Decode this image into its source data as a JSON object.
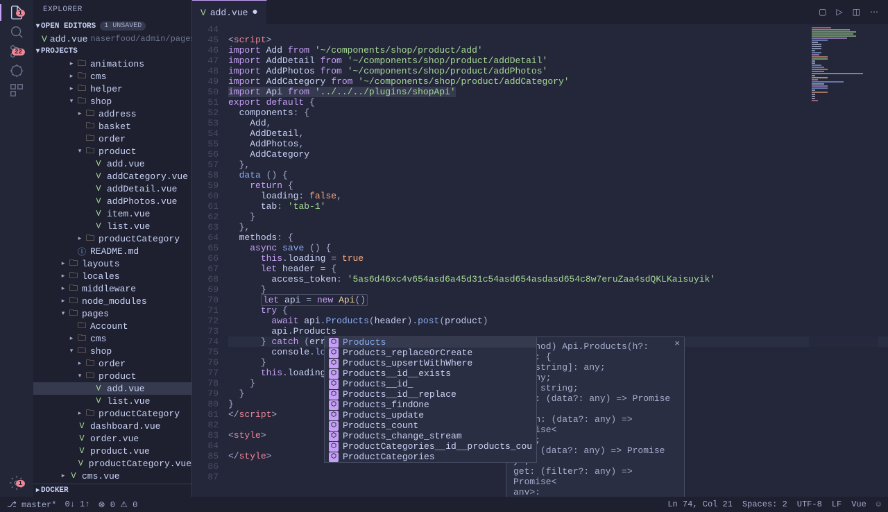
{
  "sidebar": {
    "title": "EXPLORER",
    "openEditors": {
      "label": "OPEN EDITORS",
      "badge": "1 UNSAVED",
      "items": [
        {
          "name": "add.vue",
          "path": "naserfood/admin/pages/shop/p..."
        }
      ]
    },
    "projects": {
      "label": "PROJECTS",
      "tree": [
        {
          "depth": 4,
          "type": "folder",
          "name": "animations",
          "chev": "right"
        },
        {
          "depth": 4,
          "type": "folder",
          "name": "cms",
          "chev": "right"
        },
        {
          "depth": 4,
          "type": "folder",
          "name": "helper",
          "chev": "right"
        },
        {
          "depth": 4,
          "type": "folder",
          "name": "shop",
          "chev": "down"
        },
        {
          "depth": 5,
          "type": "folder",
          "name": "address",
          "chev": "right"
        },
        {
          "depth": 5,
          "type": "folder",
          "name": "basket",
          "chev": ""
        },
        {
          "depth": 5,
          "type": "folder",
          "name": "order",
          "chev": ""
        },
        {
          "depth": 5,
          "type": "folder",
          "name": "product",
          "chev": "down"
        },
        {
          "depth": 6,
          "type": "vue",
          "name": "add.vue"
        },
        {
          "depth": 6,
          "type": "vue",
          "name": "addCategory.vue"
        },
        {
          "depth": 6,
          "type": "vue",
          "name": "addDetail.vue"
        },
        {
          "depth": 6,
          "type": "vue",
          "name": "addPhotos.vue"
        },
        {
          "depth": 6,
          "type": "vue",
          "name": "item.vue"
        },
        {
          "depth": 6,
          "type": "vue",
          "name": "list.vue"
        },
        {
          "depth": 5,
          "type": "folder",
          "name": "productCategory",
          "chev": "right"
        },
        {
          "depth": 4,
          "type": "md",
          "name": "README.md",
          "chev": ""
        },
        {
          "depth": 3,
          "type": "folder",
          "name": "layouts",
          "chev": "right"
        },
        {
          "depth": 3,
          "type": "folder",
          "name": "locales",
          "chev": "right"
        },
        {
          "depth": 3,
          "type": "folder",
          "name": "middleware",
          "chev": "right"
        },
        {
          "depth": 3,
          "type": "folder",
          "name": "node_modules",
          "chev": "right"
        },
        {
          "depth": 3,
          "type": "folder",
          "name": "pages",
          "chev": "down"
        },
        {
          "depth": 4,
          "type": "folder",
          "name": "Account",
          "chev": ""
        },
        {
          "depth": 4,
          "type": "folder",
          "name": "cms",
          "chev": "right"
        },
        {
          "depth": 4,
          "type": "folder",
          "name": "shop",
          "chev": "down"
        },
        {
          "depth": 5,
          "type": "folder",
          "name": "order",
          "chev": "right"
        },
        {
          "depth": 5,
          "type": "folder",
          "name": "product",
          "chev": "down"
        },
        {
          "depth": 6,
          "type": "vue",
          "name": "add.vue",
          "active": true
        },
        {
          "depth": 6,
          "type": "vue",
          "name": "list.vue"
        },
        {
          "depth": 5,
          "type": "folder",
          "name": "productCategory",
          "chev": "right"
        },
        {
          "depth": 4,
          "type": "vue",
          "name": "dashboard.vue"
        },
        {
          "depth": 4,
          "type": "vue",
          "name": "order.vue"
        },
        {
          "depth": 4,
          "type": "vue",
          "name": "product.vue"
        },
        {
          "depth": 4,
          "type": "vue",
          "name": "productCategory.vue"
        },
        {
          "depth": 3,
          "type": "vue",
          "name": "cms.vue",
          "chev": "right"
        }
      ]
    },
    "docker": "DOCKER"
  },
  "tabs": {
    "active": {
      "name": "add.vue"
    }
  },
  "lineStart": 44,
  "lineEnd": 87,
  "suggest": {
    "items": [
      {
        "text": "Products",
        "sel": true
      },
      {
        "text": "Products_replaceOrCreate"
      },
      {
        "text": "Products_upsertWithWhere"
      },
      {
        "text": "Products__id__exists"
      },
      {
        "text": "Products__id_"
      },
      {
        "text": "Products__id__replace"
      },
      {
        "text": "Products_findOne"
      },
      {
        "text": "Products_update"
      },
      {
        "text": "Products_count"
      },
      {
        "text": "Products_change_stream"
      },
      {
        "text": "ProductCategories__id__products_cou"
      },
      {
        "text": "ProductCategories"
      }
    ]
  },
  "hover": {
    "l1": "(method) Api.Products(h?: any): {",
    "l2": "    [x: string]: any;",
    "l3": "    h: any;",
    "l4": "    url: string;",
    "l5": "    post: (data?: any) => Promise<a",
    "l6": "ny>;",
    "l7": "    patch: (data?: any) => Promise<",
    "l8": "any>;",
    "l9": "    put: (data?: any) => Promise<an",
    "l10": "y>;",
    "l11": "    get: (filter?: any) => Promise<",
    "l12": "anv>:"
  },
  "statusbar": {
    "branch": "master*",
    "sync": "0↓ 1↑",
    "errors": "⊗ 0 ⚠ 0",
    "cursor": "Ln 74, Col 21",
    "spaces": "Spaces: 2",
    "encoding": "UTF-8",
    "eol": "LF",
    "lang": "Vue",
    "smile": "☺"
  }
}
